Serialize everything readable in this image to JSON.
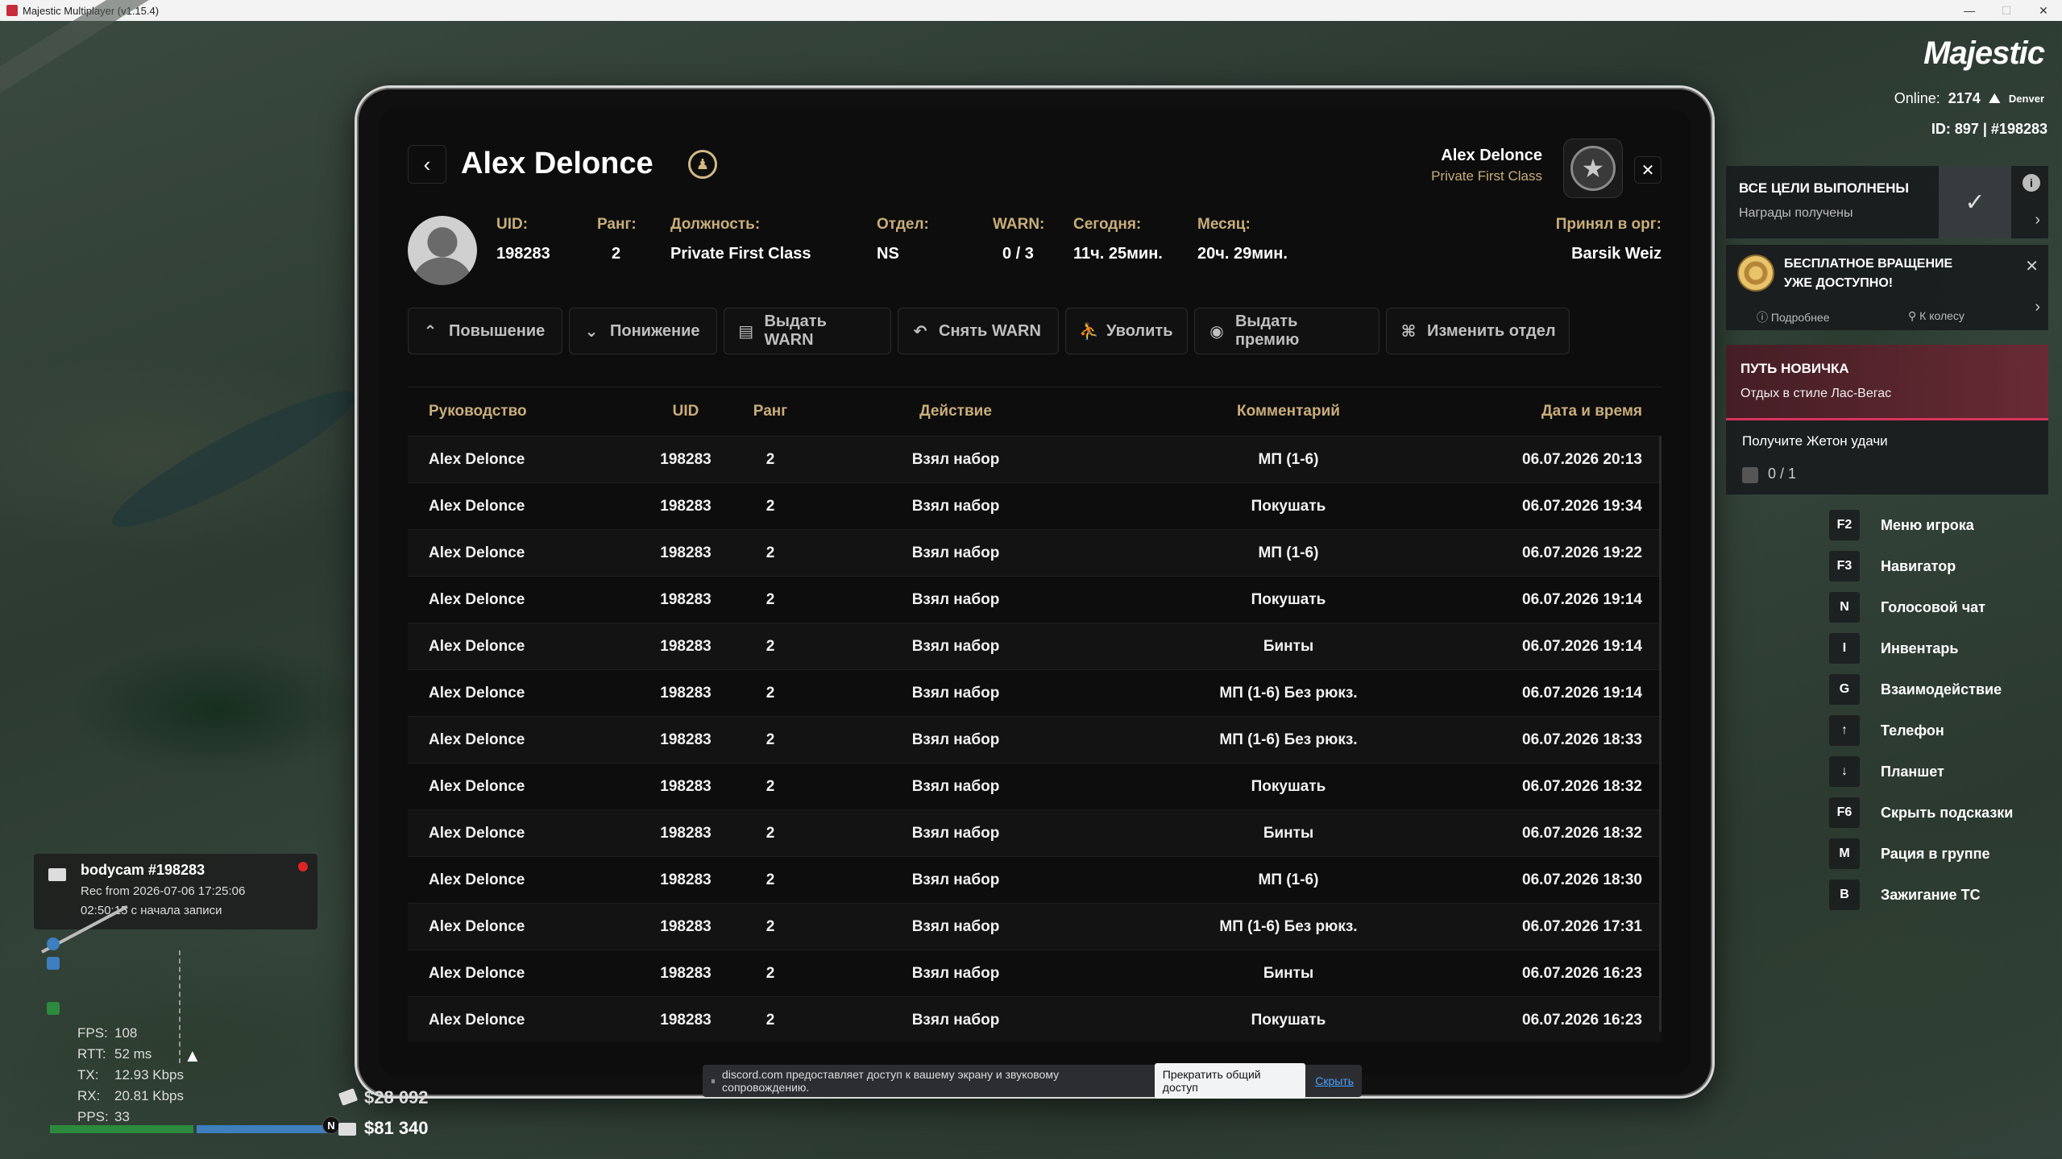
{
  "window": {
    "title": "Majestic Multiplayer (v1.15.4)"
  },
  "header": {
    "title": "Alex Delonce",
    "user_name": "Alex Delonce",
    "user_rank": "Private First Class"
  },
  "profile": {
    "uid_label": "UID:",
    "uid": "198283",
    "rank_label": "Ранг:",
    "rank": "2",
    "position_label": "Должность:",
    "position": "Private First Class",
    "dept_label": "Отдел:",
    "dept": "NS",
    "warn_label": "WARN:",
    "warn": "0 / 3",
    "today_label": "Сегодня:",
    "today": "11ч. 25мин.",
    "month_label": "Месяц:",
    "month": "20ч. 29мин.",
    "hired_label": "Принял в орг:",
    "hired_by": "Barsik Weiz"
  },
  "actions": [
    {
      "label": "Повышение",
      "icon": "chevron-up-icon"
    },
    {
      "label": "Понижение",
      "icon": "chevron-down-icon"
    },
    {
      "label": "Выдать WARN",
      "icon": "document-icon"
    },
    {
      "label": "Снять WARN",
      "icon": "undo-icon"
    },
    {
      "label": "Уволить",
      "icon": "person-leave-icon"
    },
    {
      "label": "Выдать премию",
      "icon": "coin-icon"
    },
    {
      "label": "Изменить отдел",
      "icon": "hierarchy-icon"
    }
  ],
  "table": {
    "columns": [
      "Руководство",
      "UID",
      "Ранг",
      "Действие",
      "Комментарий",
      "Дата и время"
    ],
    "rows": [
      [
        "Alex Delonce",
        "198283",
        "2",
        "Взял набор",
        "МП (1-6)",
        "06.07.2026 20:13"
      ],
      [
        "Alex Delonce",
        "198283",
        "2",
        "Взял набор",
        "Покушать",
        "06.07.2026 19:34"
      ],
      [
        "Alex Delonce",
        "198283",
        "2",
        "Взял набор",
        "МП (1-6)",
        "06.07.2026 19:22"
      ],
      [
        "Alex Delonce",
        "198283",
        "2",
        "Взял набор",
        "Покушать",
        "06.07.2026 19:14"
      ],
      [
        "Alex Delonce",
        "198283",
        "2",
        "Взял набор",
        "Бинты",
        "06.07.2026 19:14"
      ],
      [
        "Alex Delonce",
        "198283",
        "2",
        "Взял набор",
        "МП (1-6) Без рюкз.",
        "06.07.2026 19:14"
      ],
      [
        "Alex Delonce",
        "198283",
        "2",
        "Взял набор",
        "МП (1-6) Без рюкз.",
        "06.07.2026 18:33"
      ],
      [
        "Alex Delonce",
        "198283",
        "2",
        "Взял набор",
        "Покушать",
        "06.07.2026 18:32"
      ],
      [
        "Alex Delonce",
        "198283",
        "2",
        "Взял набор",
        "Бинты",
        "06.07.2026 18:32"
      ],
      [
        "Alex Delonce",
        "198283",
        "2",
        "Взял набор",
        "МП (1-6)",
        "06.07.2026 18:30"
      ],
      [
        "Alex Delonce",
        "198283",
        "2",
        "Взял набор",
        "МП (1-6) Без рюкз.",
        "06.07.2026 17:31"
      ],
      [
        "Alex Delonce",
        "198283",
        "2",
        "Взял набор",
        "Бинты",
        "06.07.2026 16:23"
      ],
      [
        "Alex Delonce",
        "198283",
        "2",
        "Взял набор",
        "Покушать",
        "06.07.2026 16:23"
      ]
    ]
  },
  "discord": {
    "message": "discord.com предоставляет доступ к вашему экрану и звуковому сопровождению.",
    "stop_label": "Прекратить общий доступ",
    "hide_label": "Скрыть"
  },
  "hud": {
    "logo": "Majestic",
    "online_label": "Online:",
    "online_count": "2174",
    "server": "Denver",
    "id_line": "ID: 897 | #198283",
    "goals_title": "ВСЕ ЦЕЛИ ВЫПОЛНЕНЫ",
    "goals_sub": "Награды получены",
    "spin_title": "БЕСПЛАТНОЕ ВРАЩЕНИЕ УЖЕ ДОСТУПНО!",
    "spin_more": "Подробнее",
    "spin_wheel": "К колесу",
    "path_title": "ПУТЬ НОВИЧКА",
    "path_sub": "Отдых в стиле Лас-Вегас",
    "task_title": "Получите Жетон удачи",
    "task_progress": "0 / 1",
    "keys": [
      {
        "key": "F2",
        "label": "Меню игрока"
      },
      {
        "key": "F3",
        "label": "Навигатор"
      },
      {
        "key": "N",
        "label": "Голосовой чат"
      },
      {
        "key": "I",
        "label": "Инвентарь"
      },
      {
        "key": "G",
        "label": "Взаимодействие"
      },
      {
        "key": "↑",
        "label": "Телефон"
      },
      {
        "key": "↓",
        "label": "Планшет"
      },
      {
        "key": "F6",
        "label": "Скрыть подсказки"
      },
      {
        "key": "M",
        "label": "Рация в группе"
      },
      {
        "key": "B",
        "label": "Зажигание ТС"
      }
    ]
  },
  "bodycam": {
    "title": "bodycam #198283",
    "rec": "Rec from 2026-07-06 17:25:06",
    "elapsed": "02:50:15 с начала записи"
  },
  "netstats": [
    {
      "k": "FPS:",
      "v": "108"
    },
    {
      "k": "RTT:",
      "v": "52 ms"
    },
    {
      "k": "TX:",
      "v": "12.93 Kbps"
    },
    {
      "k": "RX:",
      "v": "20.81 Kbps"
    },
    {
      "k": "PPS:",
      "v": "33"
    }
  ],
  "money": {
    "cash": "$28 092",
    "bank": "$81 340"
  },
  "minimap": {
    "north": "N"
  }
}
